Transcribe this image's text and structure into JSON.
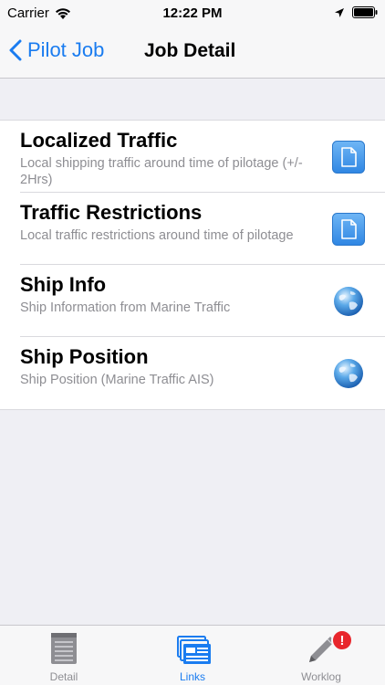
{
  "status_bar": {
    "carrier": "Carrier",
    "time": "12:22 PM"
  },
  "nav": {
    "back_label": "Pilot Job",
    "title": "Job Detail"
  },
  "links": [
    {
      "title": "Localized Traffic",
      "subtitle": "Local shipping traffic around time of pilotage (+/- 2Hrs)",
      "icon": "document-icon"
    },
    {
      "title": "Traffic Restrictions",
      "subtitle": "Local traffic restrictions around time of pilotage",
      "icon": "document-icon"
    },
    {
      "title": "Ship Info",
      "subtitle": "Ship Information from Marine Traffic",
      "icon": "globe-icon"
    },
    {
      "title": "Ship Position",
      "subtitle": "Ship Position (Marine Traffic AIS)",
      "icon": "globe-icon"
    }
  ],
  "tabs": [
    {
      "label": "Detail",
      "icon": "notepad-icon",
      "active": false
    },
    {
      "label": "Links",
      "icon": "links-icon",
      "active": true
    },
    {
      "label": "Worklog",
      "icon": "pencil-icon",
      "active": false,
      "badge": "!"
    }
  ],
  "colors": {
    "accent": "#1a7cf0",
    "badge": "#e8262c",
    "subtitle": "#8e8e93"
  }
}
